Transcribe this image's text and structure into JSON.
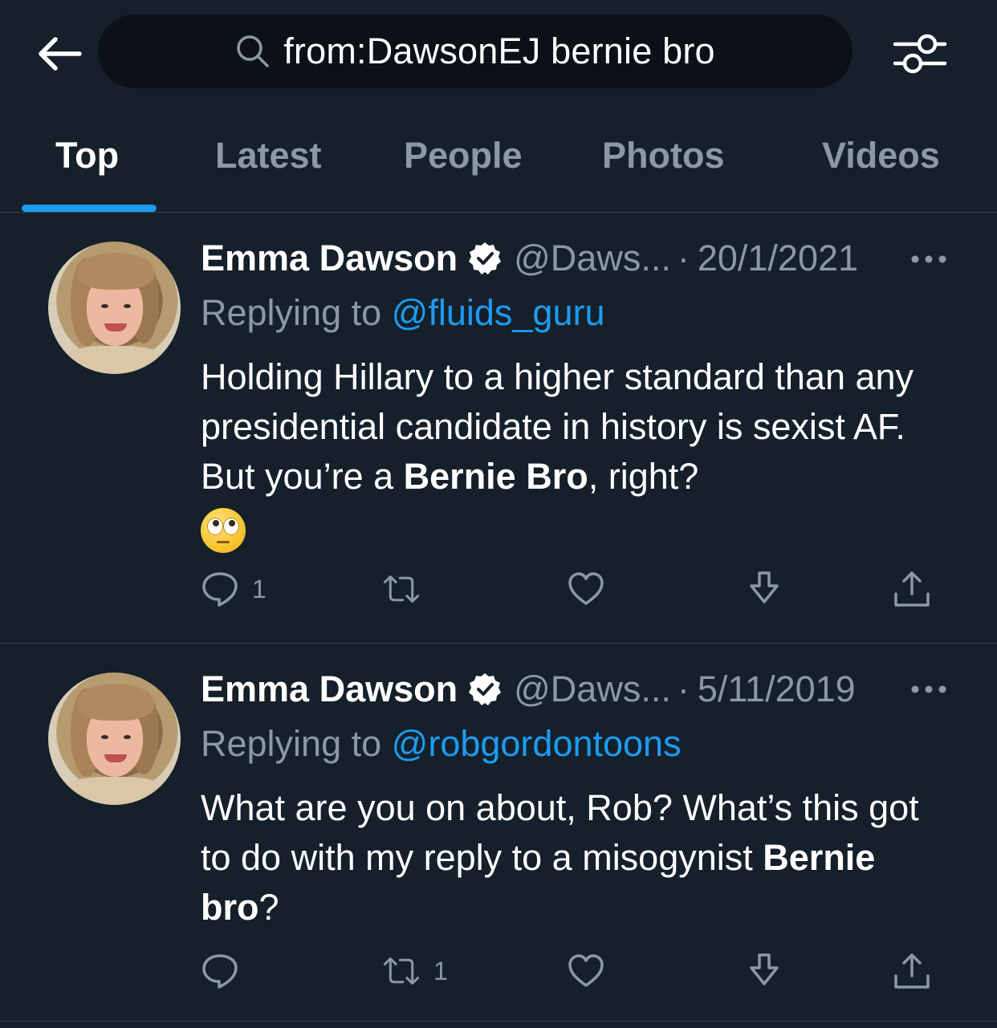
{
  "search": {
    "query": "from:DawsonEJ bernie bro"
  },
  "tabs": [
    {
      "label": "Top",
      "active": true
    },
    {
      "label": "Latest",
      "active": false
    },
    {
      "label": "People",
      "active": false
    },
    {
      "label": "Photos",
      "active": false
    },
    {
      "label": "Videos",
      "active": false
    }
  ],
  "tweets": [
    {
      "author_name": "Emma Dawson",
      "handle": "@Daws...",
      "separator": "·",
      "date": "20/1/2021",
      "replying_prefix": "Replying to",
      "replying_to": "@fluids_guru",
      "body_part1": "Holding Hillary to a higher standard than any presidential candidate in history is sexist AF. But you’re a ",
      "body_bold": "Bernie Bro",
      "body_part2": ", right?",
      "emoji": "face-with-rolling-eyes",
      "reply_count": "1",
      "retweet_count": "",
      "like_count": ""
    },
    {
      "author_name": "Emma Dawson",
      "handle": "@Daws...",
      "separator": "·",
      "date": "5/11/2019",
      "replying_prefix": "Replying to",
      "replying_to": "@robgordontoons",
      "body_part1": "What are you on about, Rob? What’s this got to do with my reply to a misogynist ",
      "body_bold": "Bernie bro",
      "body_part2": "?",
      "reply_count": "",
      "retweet_count": "1",
      "like_count": ""
    }
  ],
  "colors": {
    "background": "#15202b",
    "search_bg": "#0c1117",
    "accent": "#1d9bf0",
    "secondary_text": "#8b98a5",
    "divider": "#38444d"
  }
}
